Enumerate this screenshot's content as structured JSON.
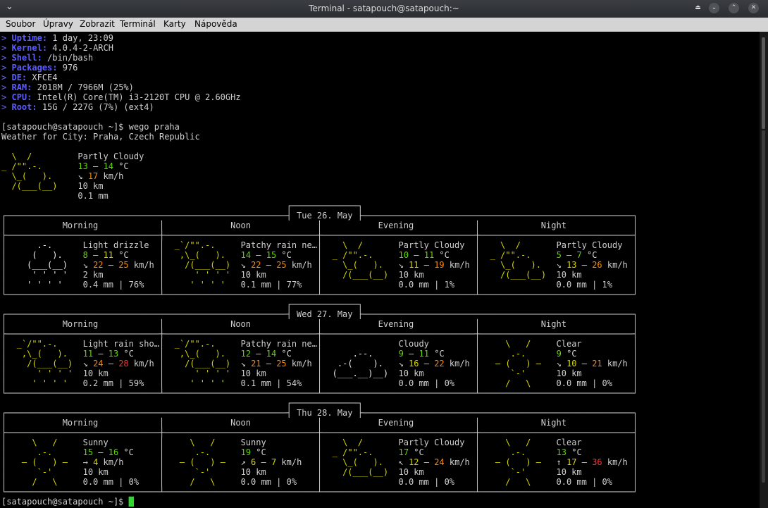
{
  "window": {
    "title": "Terminal - satapouch@satapouch:~",
    "menu": [
      "Soubor",
      "Úpravy",
      "Zobrazit",
      "Terminál",
      "Karty",
      "Nápověda"
    ]
  },
  "sysinfo": [
    {
      "key": "Uptime:",
      "value": "1 day, 23:09"
    },
    {
      "key": "Kernel:",
      "value": "4.0.4-2-ARCH"
    },
    {
      "key": "Shell:",
      "value": "/bin/bash"
    },
    {
      "key": "Packages:",
      "value": "976"
    },
    {
      "key": "DE:",
      "value": "XFCE4"
    },
    {
      "key": "RAM:",
      "value": "2018M / 7966M (25%)"
    },
    {
      "key": "CPU:",
      "value": "Intel(R) Core(TM) i3-2120T CPU @ 2.60GHz"
    },
    {
      "key": "Root:",
      "value": "15G / 227G (7%) (ext4)"
    }
  ],
  "prompt": "[satapouch@satapouch ~]$",
  "command": "wego praha",
  "location_line": "Weather for City: Praha, Czech Republic",
  "current": {
    "condition": "Partly Cloudy",
    "temp_lo": "13",
    "temp_hi": "14",
    "temp_unit": "°C",
    "wind_arrow": "↘",
    "wind": "17",
    "wind_unit": "km/h",
    "visibility": "10 km",
    "precip": "0.1 mm"
  },
  "periods": [
    "Morning",
    "Noon",
    "Evening",
    "Night"
  ],
  "days": [
    {
      "date": "Tue 26. May",
      "cells": [
        {
          "icon": "drizzle",
          "cond": "Light drizzle",
          "t": [
            "8",
            "11"
          ],
          "tc": [
            "gr",
            "y"
          ],
          "arrow": "↘",
          "w": [
            "22",
            "25"
          ],
          "wc": [
            "o",
            "o"
          ],
          "vis": "2 km",
          "prec": "0.4 mm | 76%"
        },
        {
          "icon": "patchy",
          "cond": "Patchy rain ne…",
          "t": [
            "14",
            "15"
          ],
          "tc": [
            "gr",
            "gr"
          ],
          "arrow": "↘",
          "w": [
            "22",
            "25"
          ],
          "wc": [
            "o",
            "o"
          ],
          "vis": "10 km",
          "prec": "0.1 mm | 77%"
        },
        {
          "icon": "partly",
          "cond": "Partly Cloudy",
          "t": [
            "10",
            "11"
          ],
          "tc": [
            "gr",
            "gr"
          ],
          "arrow": "↘",
          "w": [
            "11",
            "19"
          ],
          "wc": [
            "y",
            "o"
          ],
          "vis": "10 km",
          "prec": "0.0 mm | 1%"
        },
        {
          "icon": "partly",
          "cond": "Partly Cloudy",
          "t": [
            "5",
            "7"
          ],
          "tc": [
            "gr",
            "gr"
          ],
          "arrow": "↘",
          "w": [
            "13",
            "26"
          ],
          "wc": [
            "y",
            "o"
          ],
          "vis": "10 km",
          "prec": "0.0 mm | 1%"
        }
      ]
    },
    {
      "date": "Wed 27. May",
      "cells": [
        {
          "icon": "patchy",
          "cond": "Light rain sho…",
          "t": [
            "11",
            "13"
          ],
          "tc": [
            "gr",
            "gr"
          ],
          "arrow": "↘",
          "w": [
            "24",
            "28"
          ],
          "wc": [
            "o",
            "r"
          ],
          "vis": "10 km",
          "prec": "0.2 mm | 59%"
        },
        {
          "icon": "patchy",
          "cond": "Patchy rain ne…",
          "t": [
            "12",
            "14"
          ],
          "tc": [
            "gr",
            "gr"
          ],
          "arrow": "↘",
          "w": [
            "21",
            "25"
          ],
          "wc": [
            "o",
            "o"
          ],
          "vis": "10 km",
          "prec": "0.1 mm | 54%"
        },
        {
          "icon": "cloudy",
          "cond": "Cloudy",
          "t": [
            "9",
            "11"
          ],
          "tc": [
            "gr",
            "gr"
          ],
          "arrow": "↘",
          "w": [
            "16",
            "22"
          ],
          "wc": [
            "y",
            "o"
          ],
          "vis": "10 km",
          "prec": "0.0 mm | 0%"
        },
        {
          "icon": "clear",
          "cond": "Clear",
          "t": [
            "9"
          ],
          "tc": [
            "gr"
          ],
          "arrow": "↘",
          "w": [
            "10",
            "21"
          ],
          "wc": [
            "y",
            "o"
          ],
          "vis": "10 km",
          "prec": "0.0 mm | 0%"
        }
      ]
    },
    {
      "date": "Thu 28. May",
      "cells": [
        {
          "icon": "clear",
          "cond": "Sunny",
          "t": [
            "15",
            "16"
          ],
          "tc": [
            "gr",
            "gr"
          ],
          "arrow": "→",
          "w": [
            "4"
          ],
          "wc": [
            "y"
          ],
          "vis": "10 km",
          "prec": "0.0 mm | 0%"
        },
        {
          "icon": "clear",
          "cond": "Sunny",
          "t": [
            "19"
          ],
          "tc": [
            "gr"
          ],
          "arrow": "↗",
          "w": [
            "6",
            "7"
          ],
          "wc": [
            "y",
            "y"
          ],
          "vis": "10 km",
          "prec": "0.0 mm | 0%"
        },
        {
          "icon": "partly",
          "cond": "Partly Cloudy",
          "t": [
            "17"
          ],
          "tc": [
            "gr"
          ],
          "arrow": "↖",
          "w": [
            "12",
            "24"
          ],
          "wc": [
            "y",
            "o"
          ],
          "vis": "10 km",
          "prec": "0.0 mm | 0%"
        },
        {
          "icon": "clear",
          "cond": "Clear",
          "t": [
            "13"
          ],
          "tc": [
            "gr"
          ],
          "arrow": "↑",
          "w": [
            "17",
            "36"
          ],
          "wc": [
            "y",
            "r"
          ],
          "vis": "10 km",
          "prec": "0.0 mm | 0%"
        }
      ]
    }
  ],
  "final_prompt": "[satapouch@satapouch ~]$"
}
